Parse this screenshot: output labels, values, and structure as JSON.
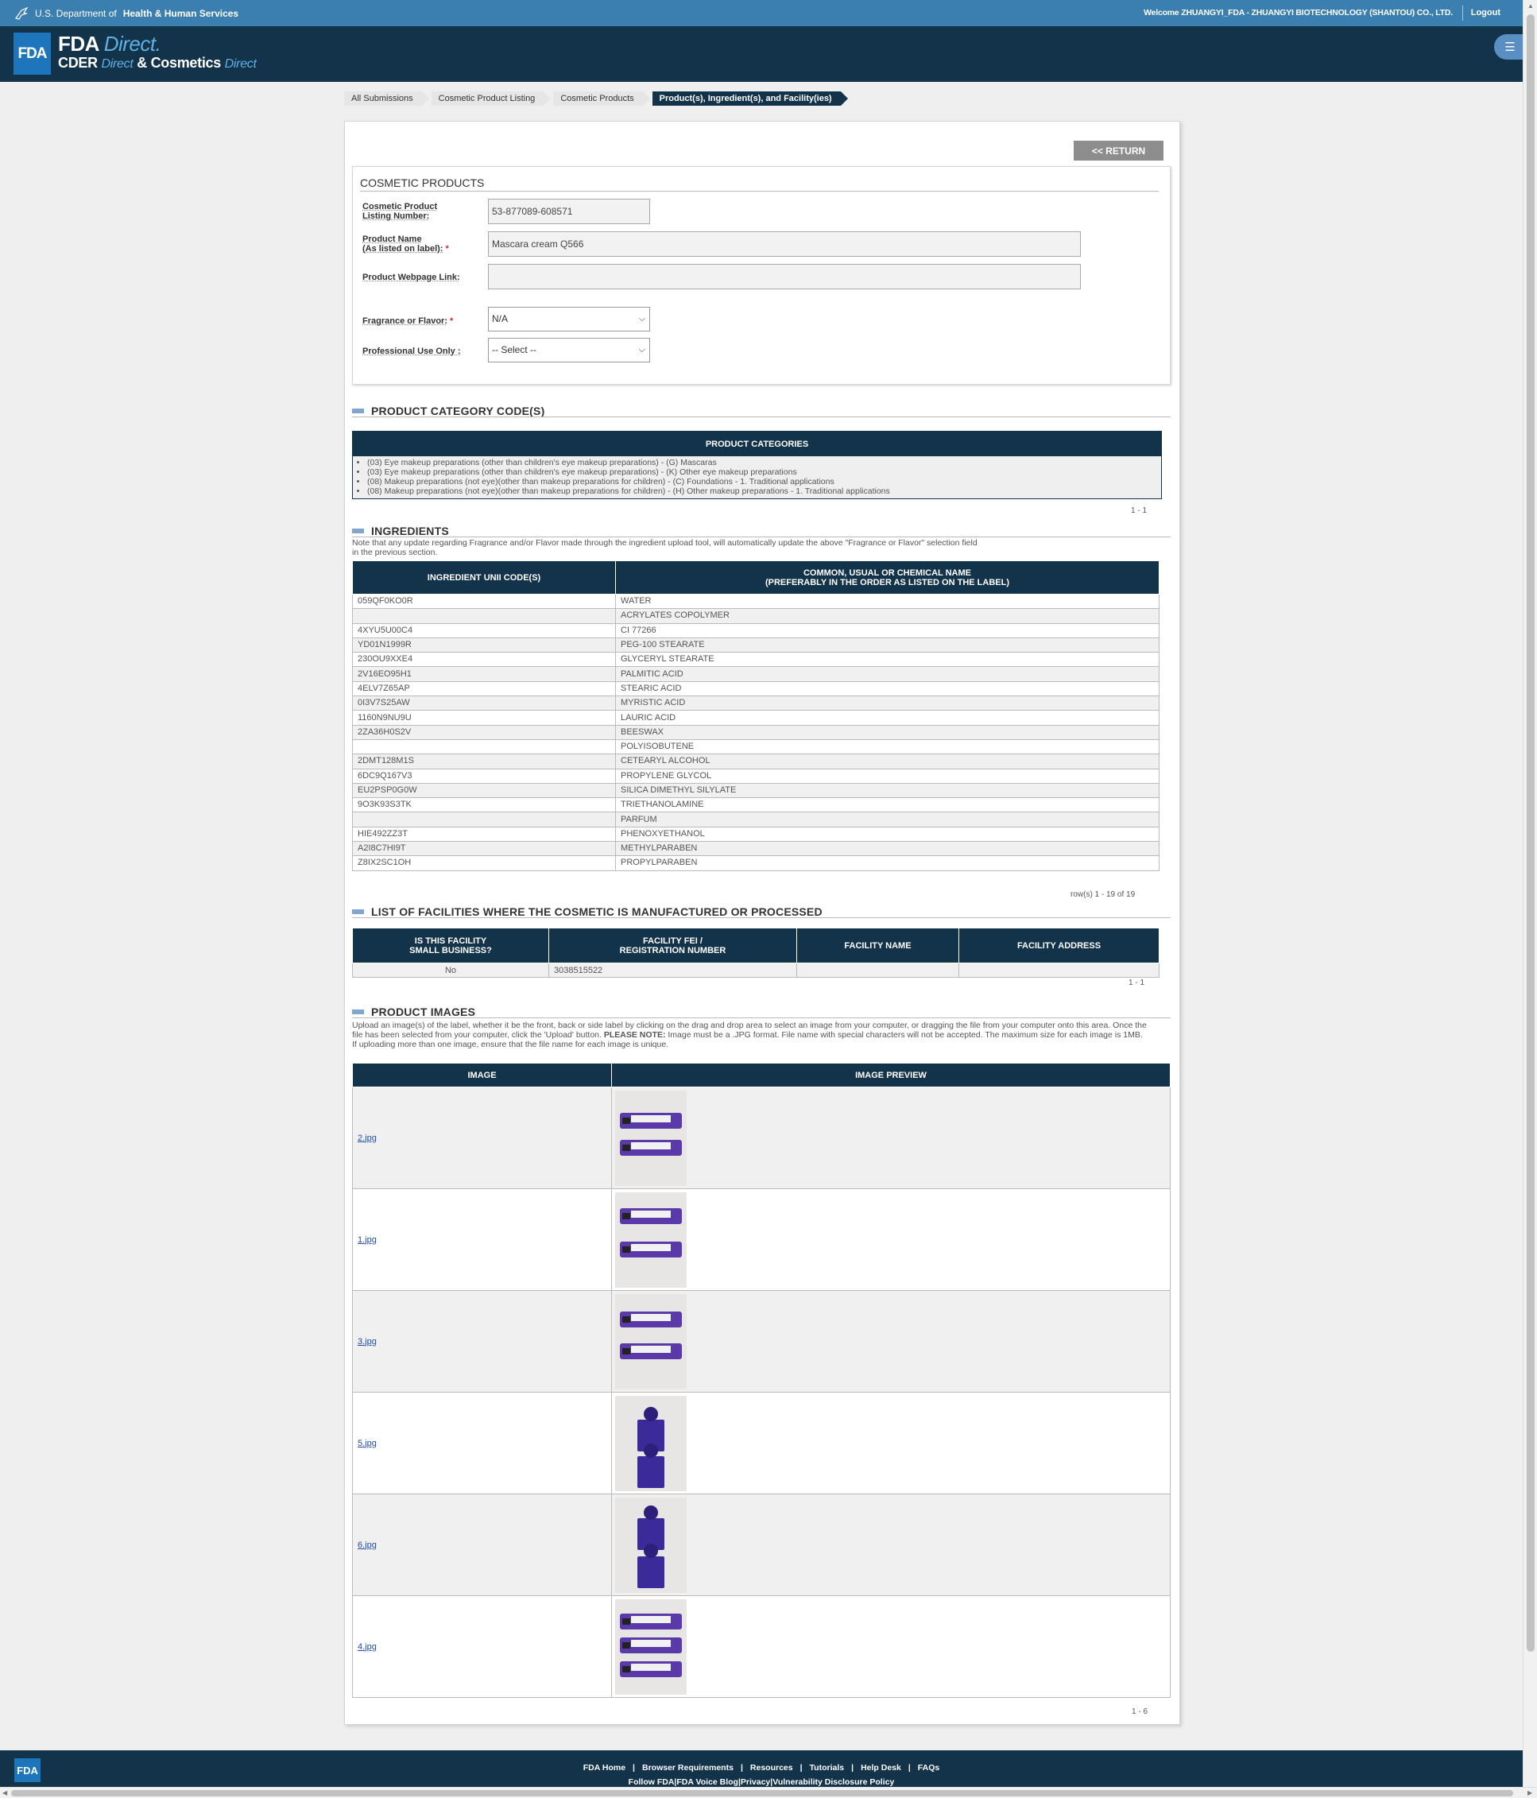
{
  "topbar": {
    "hhs_prefix": "U.S. Department of",
    "hhs_bold": "Health & Human Services",
    "welcome": "Welcome ZHUANGYI_FDA - ZHUANGYI BIOTECHNOLOGY (SHANTOU) CO., LTD.",
    "logout": "Logout"
  },
  "header": {
    "logo": "FDA",
    "line1": "FDA",
    "line1_italic": "Direct.",
    "cder": "CDER",
    "direct1": "Direct",
    "amp": "&",
    "cosmetics": "Cosmetics",
    "direct2": "Direct",
    "menu_icon": "translate-icon"
  },
  "breadcrumb": [
    "All Submissions",
    "Cosmetic Product Listing",
    "Cosmetic Products",
    "Product(s), Ingredient(s), and Facility(ies)"
  ],
  "return_button": "<< RETURN",
  "cosmetic_products": {
    "title": "COSMETIC PRODUCTS",
    "listing_label_1": "Cosmetic Product",
    "listing_label_2": "Listing Number:",
    "listing_value": "53-877089-608571",
    "name_label_1": "Product Name",
    "name_label_2": "(As listed on label):",
    "name_value": "Mascara cream Q566",
    "webpage_label": "Product Webpage Link:",
    "webpage_value": "",
    "fragrance_label": "Fragrance or Flavor:",
    "fragrance_value": "N/A",
    "professional_label": "Professional Use Only :",
    "professional_value": "-- Select --",
    "required_mark": "*"
  },
  "categories": {
    "title": "PRODUCT CATEGORY CODE(S)",
    "header": "PRODUCT CATEGORIES",
    "items": [
      "(03) Eye makeup preparations (other than children's eye makeup preparations) - (G) Mascaras",
      "(03) Eye makeup preparations (other than children's eye makeup preparations) - (K) Other eye makeup preparations",
      "(08) Makeup preparations (not eye)(other than makeup preparations for children) - (C) Foundations - 1. Traditional applications",
      "(08) Makeup preparations (not eye)(other than makeup preparations for children) - (H) Other makeup preparations - 1. Traditional applications"
    ],
    "pager": "1 - 1"
  },
  "ingredients": {
    "title": "INGREDIENTS",
    "note_1": "Note that any update regarding Fragrance and/or Flavor made through the ingredient upload tool, will automatically update the above \"Fragrance or Flavor\" selection field",
    "note_2": "in the previous section.",
    "col1": "INGREDIENT UNII CODE(S)",
    "col2_1": "COMMON, USUAL OR CHEMICAL NAME",
    "col2_2": "(PREFERABLY IN THE ORDER AS LISTED ON THE LABEL)",
    "rows": [
      [
        "059QF0KO0R",
        "WATER"
      ],
      [
        "",
        "ACRYLATES COPOLYMER"
      ],
      [
        "4XYU5U00C4",
        "CI 77266"
      ],
      [
        "YD01N1999R",
        "PEG-100 STEARATE"
      ],
      [
        "230OU9XXE4",
        "GLYCERYL STEARATE"
      ],
      [
        "2V16EO95H1",
        "PALMITIC ACID"
      ],
      [
        "4ELV7Z65AP",
        "STEARIC ACID"
      ],
      [
        "0I3V7S25AW",
        "MYRISTIC ACID"
      ],
      [
        "1160N9NU9U",
        "LAURIC ACID"
      ],
      [
        "2ZA36H0S2V",
        "BEESWAX"
      ],
      [
        "",
        "POLYISOBUTENE"
      ],
      [
        "2DMT128M1S",
        "CETEARYL ALCOHOL"
      ],
      [
        "6DC9Q167V3",
        "PROPYLENE GLYCOL"
      ],
      [
        "EU2PSP0G0W",
        "SILICA DIMETHYL SILYLATE"
      ],
      [
        "9O3K93S3TK",
        "TRIETHANOLAMINE"
      ],
      [
        "",
        "PARFUM"
      ],
      [
        "HIE492ZZ3T",
        "PHENOXYETHANOL"
      ],
      [
        "A2I8C7HI9T",
        "METHYLPARABEN"
      ],
      [
        "Z8IX2SC1OH",
        "PROPYLPARABEN"
      ]
    ],
    "pager": "row(s) 1 - 19 of 19"
  },
  "facilities": {
    "title": "LIST OF FACILITIES WHERE THE COSMETIC IS MANUFACTURED OR PROCESSED",
    "col1_1": "IS THIS FACILITY",
    "col1_2": "SMALL BUSINESS?",
    "col2_1": "FACILITY FEI /",
    "col2_2": "REGISTRATION NUMBER",
    "col3": "FACILITY NAME",
    "col4": "FACILITY ADDRESS",
    "row": [
      "No",
      "3038515522",
      "",
      ""
    ],
    "pager": "1 - 1"
  },
  "images": {
    "title": "PRODUCT IMAGES",
    "note_a": "Upload an image(s) of the label, whether it be the front, back or side label by clicking on the drag and drop area to select an image from your computer, or dragging the file from your computer onto this area. Once the",
    "note_b": "file has been selected from your computer, click the 'Upload' button.",
    "note_bold": "PLEASE NOTE:",
    "note_c": "Image must be a .JPG format. File name with special characters will not be accepted. The maximum size for each image is 1MB.",
    "note_d": "If uploading more than one image, ensure that the file name for each image is unique.",
    "col1": "IMAGE",
    "col2": "IMAGE PREVIEW",
    "files": [
      "2.jpg",
      "1.jpg",
      "3.jpg",
      "5.jpg",
      "6.jpg",
      "4.jpg"
    ],
    "pager": "1 - 6"
  },
  "footer": {
    "logo": "FDA",
    "links": [
      "FDA Home",
      "Browser Requirements",
      "Resources",
      "Tutorials",
      "Help Desk",
      "FAQs"
    ],
    "links2": [
      "Follow FDA",
      "FDA Voice Blog",
      "Privacy",
      "Vulnerability Disclosure Policy"
    ]
  }
}
